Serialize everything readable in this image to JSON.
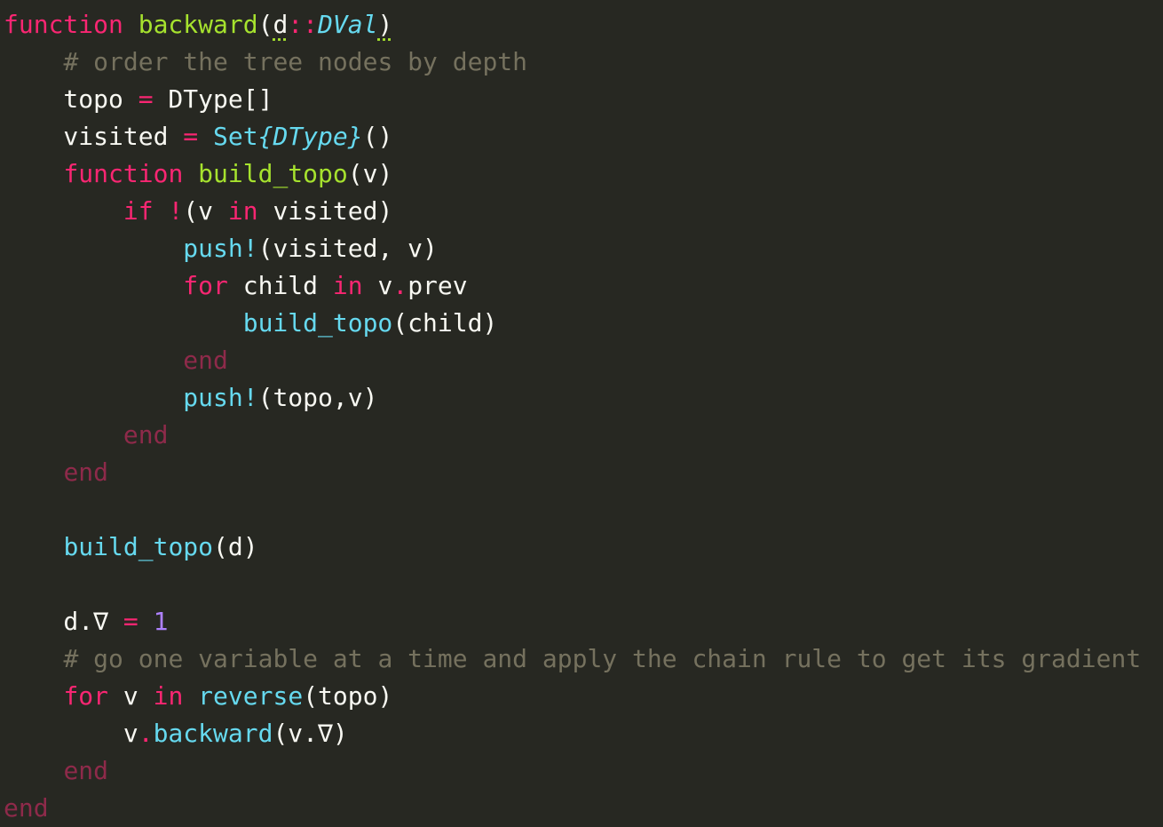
{
  "editor": {
    "background": "#272822",
    "colors": {
      "keyword": "#f92672",
      "end_keyword": "#8e2a4a",
      "function_name": "#a6e22e",
      "call": "#66d9ef",
      "type": "#66d9ef",
      "operator": "#f92672",
      "number": "#ae81ff",
      "comment": "#75715e",
      "text": "#f8f8f2"
    },
    "lines": [
      [
        {
          "t": "function",
          "c": "kw"
        },
        {
          "t": " ",
          "c": "plain"
        },
        {
          "t": "backward",
          "c": "fn"
        },
        {
          "t": "(",
          "c": "plain"
        },
        {
          "t": "d",
          "c": "plain",
          "warn": true
        },
        {
          "t": "::",
          "c": "op"
        },
        {
          "t": "DVal",
          "c": "type"
        },
        {
          "t": ")",
          "c": "plain",
          "warn": true
        }
      ],
      [
        {
          "t": "    ",
          "c": "plain"
        },
        {
          "t": "# order the tree nodes by depth",
          "c": "com"
        }
      ],
      [
        {
          "t": "    topo ",
          "c": "plain"
        },
        {
          "t": "=",
          "c": "op"
        },
        {
          "t": " DType[]",
          "c": "plain"
        }
      ],
      [
        {
          "t": "    visited ",
          "c": "plain"
        },
        {
          "t": "=",
          "c": "op"
        },
        {
          "t": " ",
          "c": "plain"
        },
        {
          "t": "Set",
          "c": "call"
        },
        {
          "t": "{DType}",
          "c": "type"
        },
        {
          "t": "()",
          "c": "plain"
        }
      ],
      [
        {
          "t": "    ",
          "c": "plain"
        },
        {
          "t": "function",
          "c": "kw"
        },
        {
          "t": " ",
          "c": "plain"
        },
        {
          "t": "build_topo",
          "c": "fn"
        },
        {
          "t": "(v)",
          "c": "plain"
        }
      ],
      [
        {
          "t": "        ",
          "c": "plain"
        },
        {
          "t": "if",
          "c": "kw"
        },
        {
          "t": " ",
          "c": "plain"
        },
        {
          "t": "!",
          "c": "op"
        },
        {
          "t": "(v ",
          "c": "plain"
        },
        {
          "t": "in",
          "c": "kw"
        },
        {
          "t": " visited)",
          "c": "plain"
        }
      ],
      [
        {
          "t": "            ",
          "c": "plain"
        },
        {
          "t": "push!",
          "c": "call"
        },
        {
          "t": "(visited, v)",
          "c": "plain"
        }
      ],
      [
        {
          "t": "            ",
          "c": "plain"
        },
        {
          "t": "for",
          "c": "kw"
        },
        {
          "t": " child ",
          "c": "plain"
        },
        {
          "t": "in",
          "c": "kw"
        },
        {
          "t": " v",
          "c": "plain"
        },
        {
          "t": ".",
          "c": "op"
        },
        {
          "t": "prev",
          "c": "plain"
        }
      ],
      [
        {
          "t": "                ",
          "c": "plain"
        },
        {
          "t": "build_topo",
          "c": "call"
        },
        {
          "t": "(child)",
          "c": "plain"
        }
      ],
      [
        {
          "t": "            ",
          "c": "plain"
        },
        {
          "t": "end",
          "c": "end"
        }
      ],
      [
        {
          "t": "            ",
          "c": "plain"
        },
        {
          "t": "push!",
          "c": "call"
        },
        {
          "t": "(topo,v)",
          "c": "plain"
        }
      ],
      [
        {
          "t": "        ",
          "c": "plain"
        },
        {
          "t": "end",
          "c": "end"
        }
      ],
      [
        {
          "t": "    ",
          "c": "plain"
        },
        {
          "t": "end",
          "c": "end"
        }
      ],
      [],
      [
        {
          "t": "    ",
          "c": "plain"
        },
        {
          "t": "build_topo",
          "c": "call"
        },
        {
          "t": "(d)",
          "c": "plain"
        }
      ],
      [],
      [
        {
          "t": "    d.∇ ",
          "c": "plain"
        },
        {
          "t": "=",
          "c": "op"
        },
        {
          "t": " ",
          "c": "plain"
        },
        {
          "t": "1",
          "c": "num"
        }
      ],
      [
        {
          "t": "    ",
          "c": "plain"
        },
        {
          "t": "# go one variable at a time and apply the chain rule to get its gradient",
          "c": "com"
        }
      ],
      [
        {
          "t": "    ",
          "c": "plain"
        },
        {
          "t": "for",
          "c": "kw"
        },
        {
          "t": " v ",
          "c": "plain"
        },
        {
          "t": "in",
          "c": "kw"
        },
        {
          "t": " ",
          "c": "plain"
        },
        {
          "t": "reverse",
          "c": "call"
        },
        {
          "t": "(topo)",
          "c": "plain"
        }
      ],
      [
        {
          "t": "        v",
          "c": "plain"
        },
        {
          "t": ".",
          "c": "op"
        },
        {
          "t": "backward",
          "c": "call"
        },
        {
          "t": "(v.∇)",
          "c": "plain"
        }
      ],
      [
        {
          "t": "    ",
          "c": "plain"
        },
        {
          "t": "end",
          "c": "end"
        }
      ],
      [
        {
          "t": "end",
          "c": "end"
        }
      ]
    ]
  }
}
